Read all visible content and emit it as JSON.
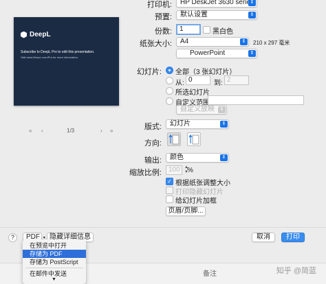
{
  "printer": {
    "label": "打印机:",
    "value": "HP DeskJet 3630 series"
  },
  "preset": {
    "label": "预置:",
    "value": "默认设置"
  },
  "copies": {
    "label": "份数:",
    "value": "1",
    "bw_label": "黑白色"
  },
  "paper": {
    "label": "纸张大小:",
    "value": "A4",
    "dims": "210 x 297 毫米"
  },
  "section_popup": "PowerPoint",
  "slides": {
    "label": "幻灯片:",
    "all": "全部（3 张幻灯片）",
    "from": "从:",
    "from_value": "0",
    "to": "到:",
    "to_value": "2",
    "selected": "所选幻灯片",
    "custom_range": "自定义范围:",
    "custom_show": "自定义放映"
  },
  "layout": {
    "label": "版式:",
    "value": "幻灯片"
  },
  "orientation": {
    "label": "方向:"
  },
  "output": {
    "label": "输出:",
    "value": "颜色"
  },
  "scale": {
    "label": "缩放比例:",
    "value": "100",
    "unit": "%"
  },
  "options": {
    "fit_paper": "根据纸张调整大小",
    "print_hidden": "打印隐藏幻灯片",
    "frame": "给幻灯片加框",
    "header_footer": "页眉/页脚..."
  },
  "preview": {
    "brand": "DeepL",
    "line1": "Subscribe to DeepL Pro to edit this presentation.",
    "line2": "Visit www.DeepL.com/Pro for more information.",
    "page": "1/3"
  },
  "footer": {
    "help": "?",
    "pdf": "PDF",
    "hide_details": "隐藏详细信息",
    "cancel": "取消",
    "print": "打印"
  },
  "pdf_menu": {
    "items": [
      "在预览中打开",
      "存储为 PDF",
      "存储为 PostScript",
      "在邮件中发送"
    ],
    "highlighted": "存储为 PDF"
  },
  "taskbar": {
    "notes": "备注",
    "watermark": "知乎 @简蓝"
  }
}
